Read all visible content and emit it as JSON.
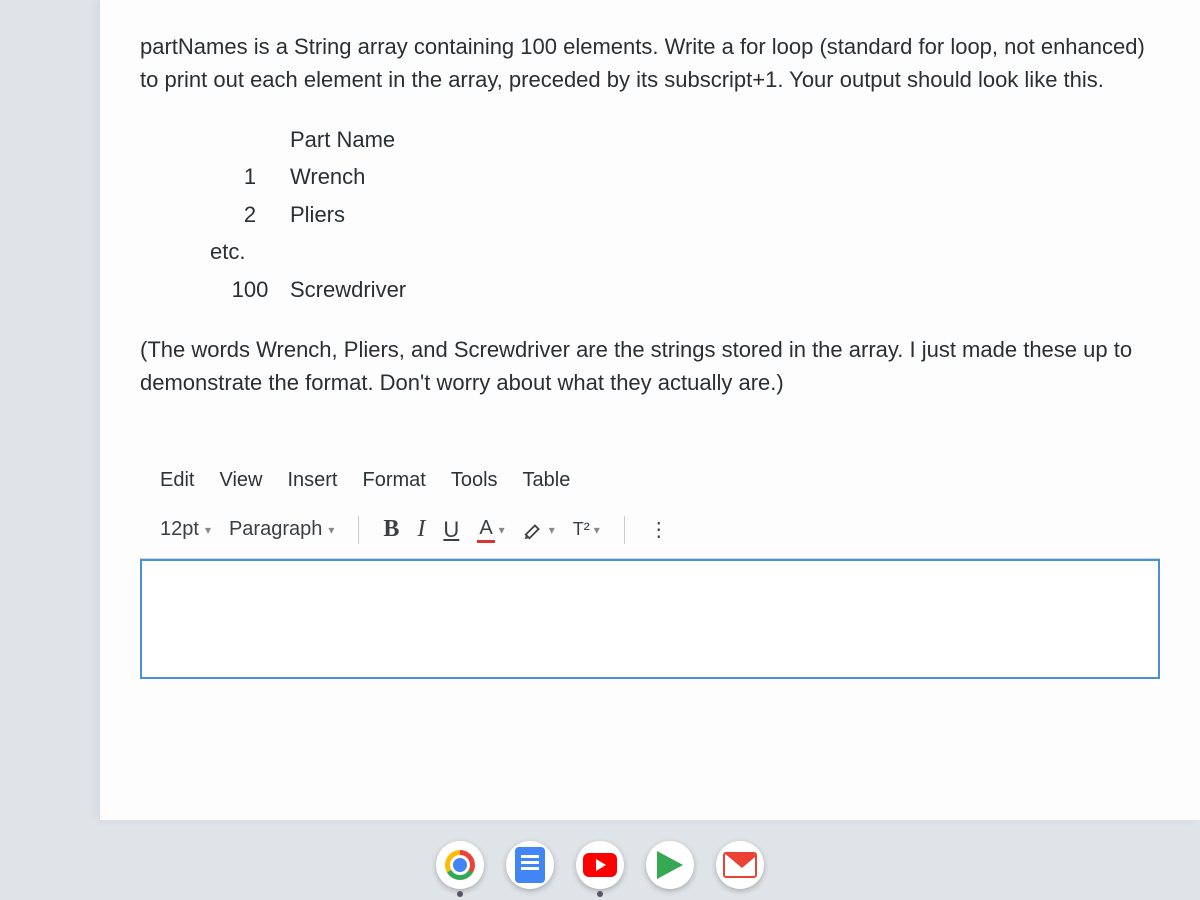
{
  "question": {
    "intro": "partNames is a String array containing 100 elements.  Write a for loop (standard for loop, not enhanced) to print out each element in the array, preceded by its subscript+1.  Your output should look like this.",
    "header_num": "",
    "header_name": "Part Name",
    "rows": [
      {
        "num": "1",
        "name": "Wrench"
      },
      {
        "num": "2",
        "name": "Pliers"
      }
    ],
    "etc": "etc.",
    "last_row": {
      "num": "100",
      "name": "Screwdriver"
    },
    "note": "(The words Wrench, Pliers, and Screwdriver are the strings stored in the array.  I just made these up to demonstrate the format.  Don't worry about what they actually are.)"
  },
  "editor": {
    "menus": [
      "Edit",
      "View",
      "Insert",
      "Format",
      "Tools",
      "Table"
    ],
    "font_size": "12pt",
    "block_style": "Paragraph",
    "bold": "B",
    "italic": "I",
    "underline": "U",
    "text_color_letter": "A",
    "superscript": "T²",
    "more": "⋮"
  }
}
